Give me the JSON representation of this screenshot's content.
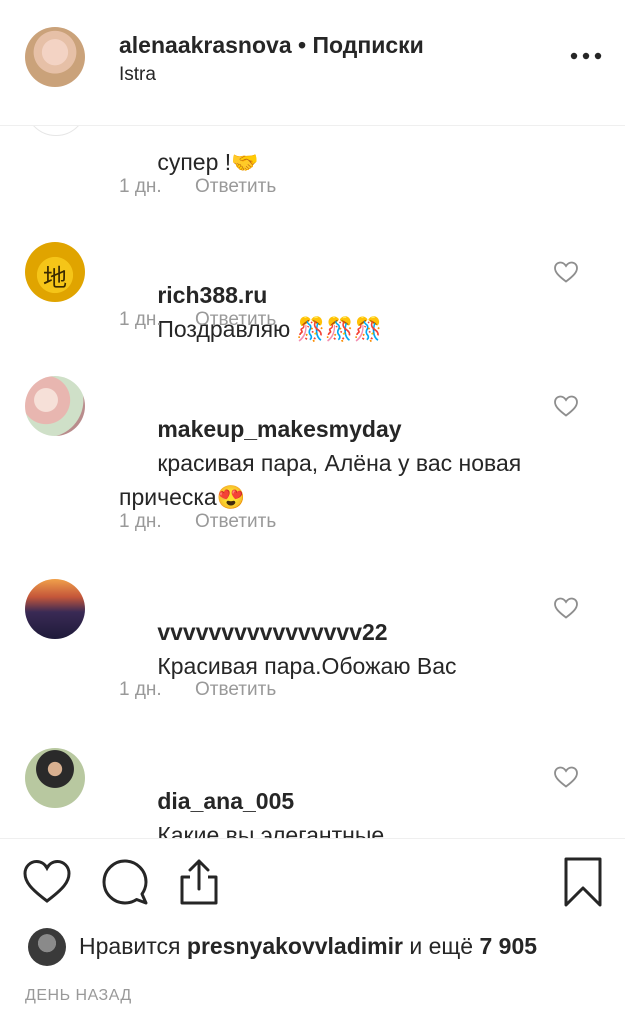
{
  "header": {
    "username": "alenaakrasnova",
    "separator": "•",
    "follow_state": "Подписки",
    "location": "Istra",
    "more_icon": "more-horizontal-icon"
  },
  "comments": [
    {
      "partial_text": "супер !",
      "time": "1 дн.",
      "reply": "Ответить"
    },
    {
      "user": "rich388.ru",
      "text": "Поздравляю 🎊🎊🎊",
      "time": "1 дн.",
      "reply": "Ответить"
    },
    {
      "user": "makeup_makesmyday",
      "text": "красивая пара, Алёна у вас новая прическа😍",
      "time": "1 дн.",
      "reply": "Ответить"
    },
    {
      "user": "vvvvvvvvvvvvvvvv22",
      "text": "Красивая пара.Обожаю Вас",
      "time": "1 дн.",
      "reply": "Ответить"
    },
    {
      "user": "dia_ana_005",
      "text": "Какие вы элегантные"
    }
  ],
  "likes": {
    "prefix": "Нравится",
    "user": "presnyakovvladimir",
    "middle": "и ещё",
    "count": "7 905"
  },
  "timestamp": "ДЕНЬ НАЗАД",
  "icons": {
    "like": "heart-icon",
    "comment": "comment-icon",
    "share": "share-icon",
    "save": "bookmark-icon"
  }
}
